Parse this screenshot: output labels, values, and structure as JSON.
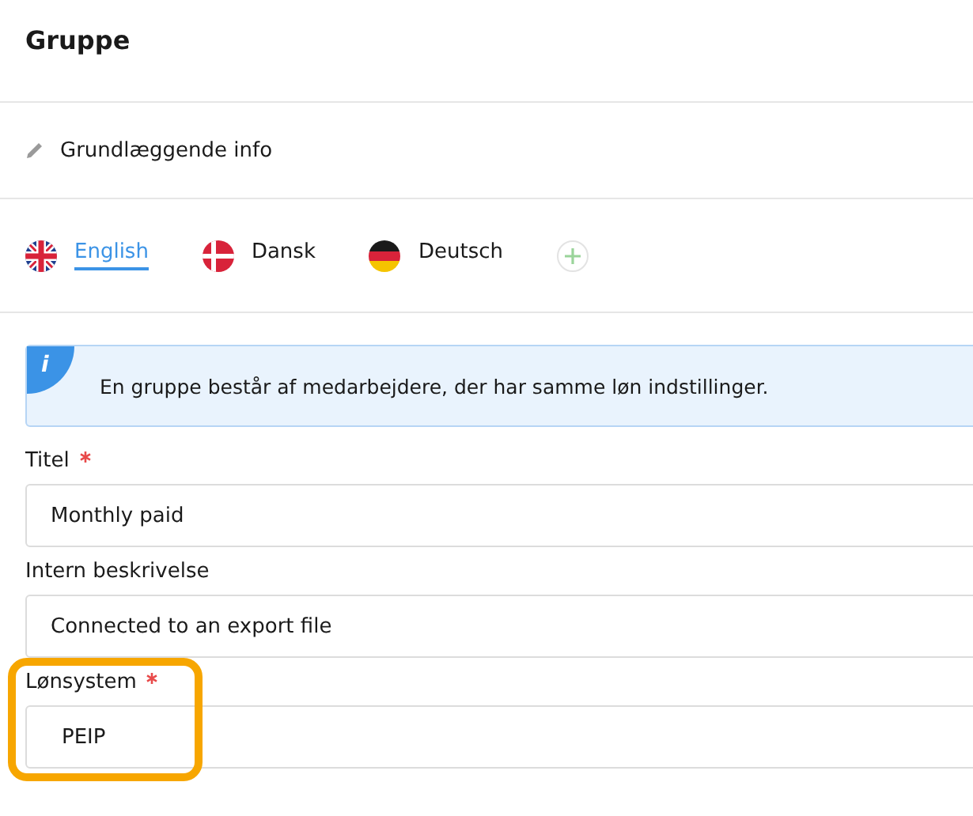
{
  "header": {
    "title": "Gruppe"
  },
  "section": {
    "title": "Grundlæggende info"
  },
  "languages": [
    {
      "label": "English",
      "kind": "uk",
      "selected": true
    },
    {
      "label": "Dansk",
      "kind": "dk",
      "selected": false
    },
    {
      "label": "Deutsch",
      "kind": "de",
      "selected": false
    }
  ],
  "info": {
    "icon": "i",
    "text": "En gruppe består af medarbejdere, der har samme løn indstillinger."
  },
  "fields": [
    {
      "label": "Titel",
      "required": true,
      "value": "Monthly paid",
      "highlighted": false
    },
    {
      "label": "Intern beskrivelse",
      "required": false,
      "value": "Connected to an export file",
      "highlighted": false
    },
    {
      "label": "Lønsystem",
      "required": true,
      "value": "PEIP",
      "highlighted": true
    }
  ]
}
